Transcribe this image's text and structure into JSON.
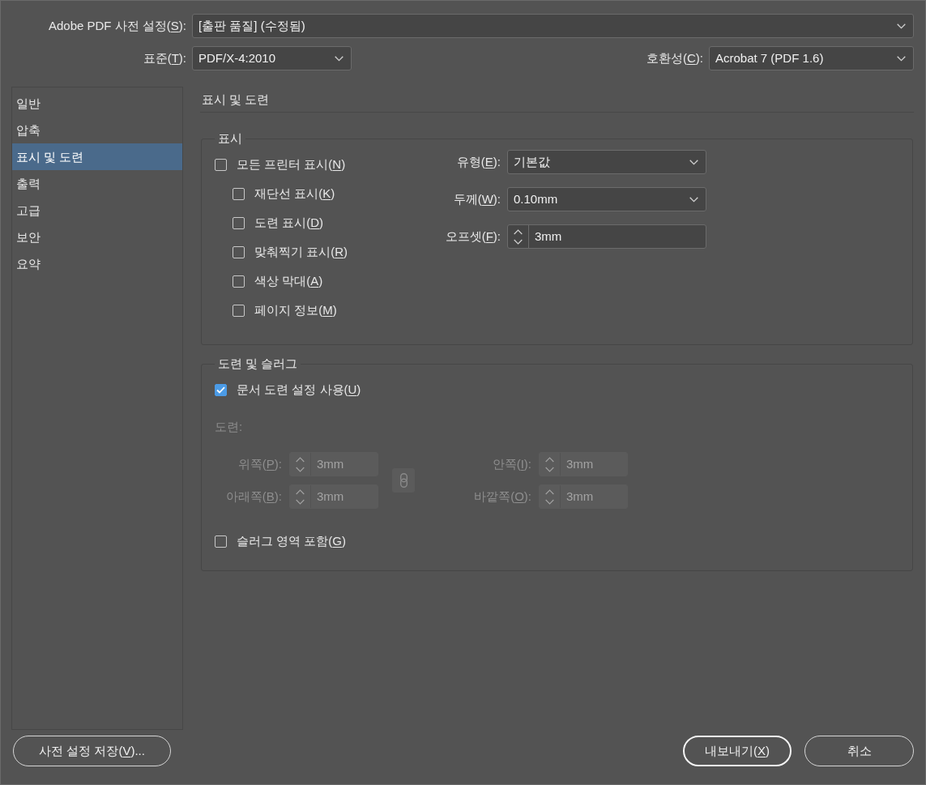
{
  "preset": {
    "label": "Adobe PDF 사전 설정(",
    "key": "S",
    "label_end": "):",
    "value": "[출판 품질] (수정됨)"
  },
  "standard": {
    "label": "표준(",
    "key": "T",
    "label_end": "):",
    "value": "PDF/X-4:2010"
  },
  "compatibility": {
    "label": "호환성(",
    "key": "C",
    "label_end": "):",
    "value": "Acrobat 7 (PDF 1.6)"
  },
  "sidebar": {
    "items": [
      {
        "label": "일반",
        "selected": false
      },
      {
        "label": "압축",
        "selected": false
      },
      {
        "label": "표시 및 도련",
        "selected": true
      },
      {
        "label": "출력",
        "selected": false
      },
      {
        "label": "고급",
        "selected": false
      },
      {
        "label": "보안",
        "selected": false
      },
      {
        "label": "요약",
        "selected": false
      }
    ]
  },
  "section_title": "표시 및 도련",
  "marks_group": {
    "title": "표시",
    "checkboxes": [
      {
        "label": "모든 프린터 표시(",
        "key": "N",
        "label_end": ")",
        "checked": false,
        "children": [
          {
            "label": "재단선 표시(",
            "key": "K",
            "label_end": ")",
            "checked": false
          },
          {
            "label": "도련 표시(",
            "key": "D",
            "label_end": ")",
            "checked": false
          },
          {
            "label": "맞춰찍기 표시(",
            "key": "R",
            "label_end": ")",
            "checked": false
          },
          {
            "label": "색상 막대(",
            "key": "A",
            "label_end": ")",
            "checked": false
          },
          {
            "label": "페이지 정보(",
            "key": "M",
            "label_end": ")",
            "checked": false
          }
        ]
      }
    ],
    "fields": [
      {
        "kind": "select",
        "label": "유형(",
        "key": "E",
        "label_end": "):",
        "value": "기본값",
        "disabled": false
      },
      {
        "kind": "select",
        "label": "두께(",
        "key": "W",
        "label_end": "):",
        "value": "0.10mm",
        "disabled": false
      },
      {
        "kind": "spinner",
        "label": "오프셋(",
        "key": "F",
        "label_end": "):",
        "value": "3mm",
        "disabled": false
      }
    ]
  },
  "bleed_group": {
    "title": "도련 및 슬러그",
    "use_document_bleed": {
      "label": "문서 도련 설정 사용(",
      "key": "U",
      "label_end": ")",
      "checked": true
    },
    "bleed_label": {
      "text": "도련:",
      "disabled": true
    },
    "left_fields": [
      {
        "kind": "spinner",
        "label": "위쪽(",
        "key": "P",
        "label_end": "):",
        "value": "3mm",
        "disabled": true
      },
      {
        "kind": "spinner",
        "label": "아래쪽(",
        "key": "B",
        "label_end": "):",
        "value": "3mm",
        "disabled": true
      }
    ],
    "link_button": {
      "disabled": true
    },
    "right_fields": [
      {
        "kind": "spinner",
        "label": "안쪽(",
        "key": "I",
        "label_end": "):",
        "value": "3mm",
        "disabled": true
      },
      {
        "kind": "spinner",
        "label": "바깥쪽(",
        "key": "O",
        "label_end": "):",
        "value": "3mm",
        "disabled": true
      }
    ],
    "include_slug": {
      "label": "슬러그 영역 포함(",
      "key": "G",
      "label_end": ")",
      "checked": false
    }
  },
  "buttons_left": [
    {
      "label": "사전 설정 저장(",
      "key": "V",
      "label_end": ")...",
      "default": false
    }
  ],
  "buttons_right": [
    {
      "label": "내보내기(",
      "key": "X",
      "label_end": ")",
      "default": true
    },
    {
      "label": "취소",
      "default": false
    }
  ]
}
